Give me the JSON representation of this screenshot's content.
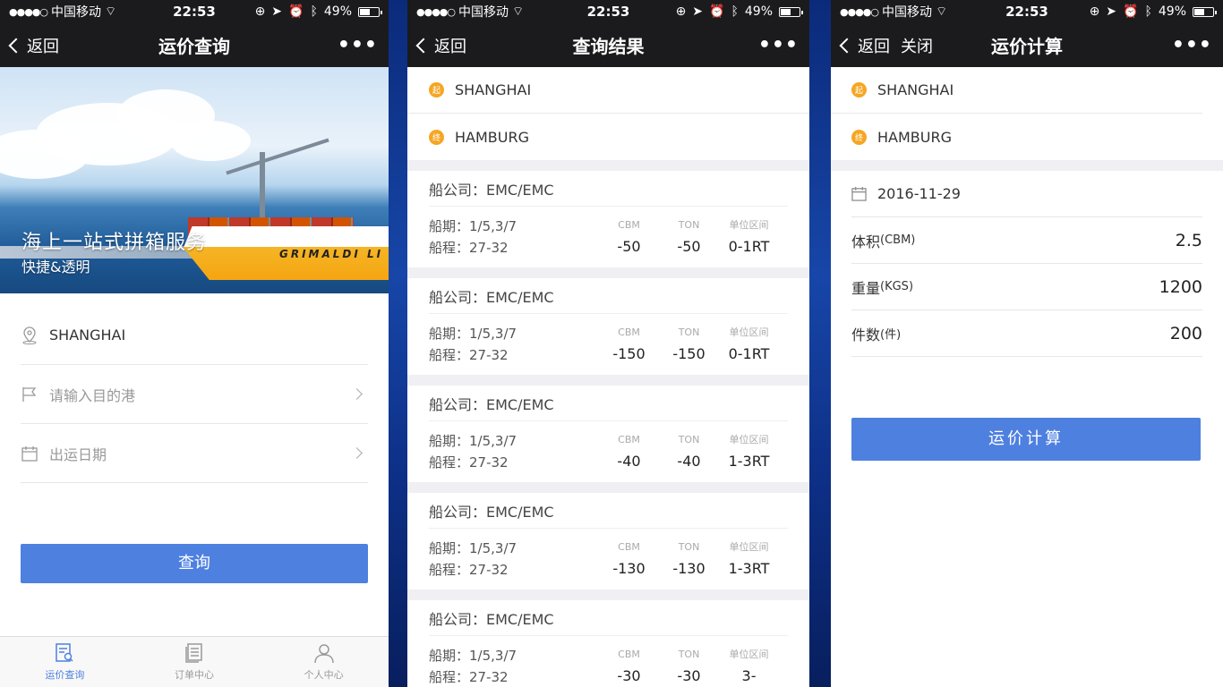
{
  "status": {
    "carrier": "中国移动",
    "time": "22:53",
    "battery": "49%",
    "battery_level": 0.49
  },
  "screen1": {
    "back": "返回",
    "title": "运价查询",
    "more": "•••",
    "banner_slogan": "海上一站式拼箱服务",
    "banner_sub": "快捷&透明",
    "ship_name": "GRIMALDI LI",
    "origin": "SHANGHAI",
    "dest_placeholder": "请输入目的港",
    "date_placeholder": "出运日期",
    "query_button": "查询",
    "tabs": [
      {
        "label": "运价查询",
        "icon": "search-document-icon"
      },
      {
        "label": "订单中心",
        "icon": "document-list-icon"
      },
      {
        "label": "个人中心",
        "icon": "person-icon"
      }
    ]
  },
  "screen2": {
    "back": "返回",
    "title": "查询结果",
    "more": "•••",
    "origin_badge": "起",
    "origin": "SHANGHAI",
    "dest_badge": "终",
    "dest": "HAMBURG",
    "headers": {
      "cbm": "CBM",
      "ton": "TON",
      "range": "单位区间"
    },
    "results": [
      {
        "company": "船公司：EMC/EMC",
        "schedule": "船期：1/5,3/7",
        "transit": "船程：27-32",
        "cbm": "-50",
        "ton": "-50",
        "range": "0-1RT"
      },
      {
        "company": "船公司：EMC/EMC",
        "schedule": "船期：1/5,3/7",
        "transit": "船程：27-32",
        "cbm": "-150",
        "ton": "-150",
        "range": "0-1RT"
      },
      {
        "company": "船公司：EMC/EMC",
        "schedule": "船期：1/5,3/7",
        "transit": "船程：27-32",
        "cbm": "-40",
        "ton": "-40",
        "range": "1-3RT"
      },
      {
        "company": "船公司：EMC/EMC",
        "schedule": "船期：1/5,3/7",
        "transit": "船程：27-32",
        "cbm": "-130",
        "ton": "-130",
        "range": "1-3RT"
      },
      {
        "company": "船公司：EMC/EMC",
        "schedule": "船期：1/5,3/7",
        "transit": "船程：27-32",
        "cbm": "-30",
        "ton": "-30",
        "range": "3-"
      }
    ]
  },
  "screen3": {
    "back": "返回",
    "close": "关闭",
    "title": "运价计算",
    "more": "•••",
    "origin_badge": "起",
    "origin": "SHANGHAI",
    "dest_badge": "终",
    "dest": "HAMBURG",
    "date": "2016-11-29",
    "volume_label": "体积",
    "volume_unit": "(CBM)",
    "volume_value": "2.5",
    "weight_label": "重量",
    "weight_unit": "(KGS)",
    "weight_value": "1200",
    "pieces_label": "件数",
    "pieces_unit": "(件)",
    "pieces_value": "200",
    "calc_button": "运价计算"
  },
  "colors": {
    "accent": "#4e80e0",
    "badge": "#f5a623",
    "navbar": "#1b1b1d"
  }
}
